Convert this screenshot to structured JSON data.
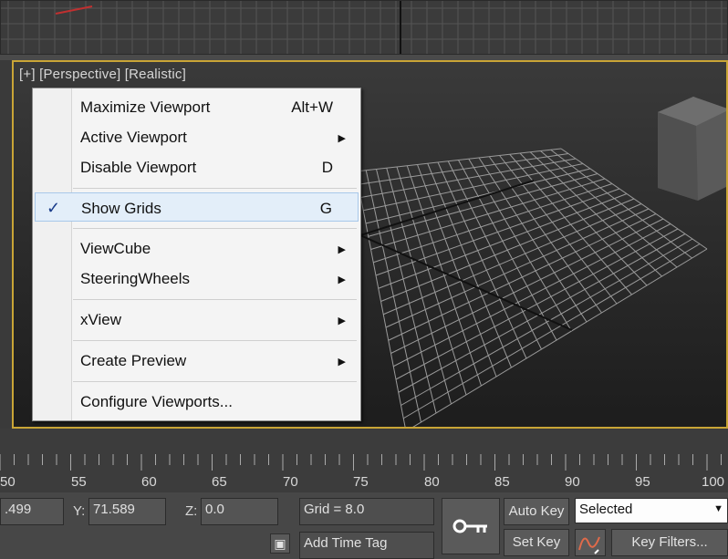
{
  "viewport": {
    "label_plus": "[+]",
    "label_view": "[Perspective]",
    "label_shading": "[Realistic]"
  },
  "context_menu": {
    "items": [
      {
        "label": "Maximize Viewport",
        "shortcut": "Alt+W",
        "submenu": false,
        "checked": false
      },
      {
        "label": "Active Viewport",
        "shortcut": "",
        "submenu": true,
        "checked": false
      },
      {
        "label": "Disable Viewport",
        "shortcut": "D",
        "submenu": false,
        "checked": false
      },
      {
        "label": "Show Grids",
        "shortcut": "G",
        "submenu": false,
        "checked": true
      },
      {
        "label": "ViewCube",
        "shortcut": "",
        "submenu": true,
        "checked": false
      },
      {
        "label": "SteeringWheels",
        "shortcut": "",
        "submenu": true,
        "checked": false
      },
      {
        "label": "xView",
        "shortcut": "",
        "submenu": true,
        "checked": false
      },
      {
        "label": "Create Preview",
        "shortcut": "",
        "submenu": true,
        "checked": false
      },
      {
        "label": "Configure Viewports...",
        "shortcut": "",
        "submenu": false,
        "checked": false
      }
    ],
    "check_glyph": "✓",
    "submenu_glyph": "▶"
  },
  "timeline": {
    "ticks": [
      "50",
      "55",
      "60",
      "65",
      "70",
      "75",
      "80",
      "85",
      "90",
      "95",
      "100"
    ]
  },
  "status": {
    "x_value": ".499",
    "y_label": "Y:",
    "y_value": "71.589",
    "z_label": "Z:",
    "z_value": "0.0",
    "grid": "Grid = 8.0",
    "add_time_tag": "Add Time Tag",
    "auto_key": "Auto Key",
    "set_key": "Set Key",
    "selection_dropdown": "Selected",
    "key_filters": "Key Filters..."
  },
  "colors": {
    "viewport_border": "#c9a536",
    "menu_bg": "#f4f4f4",
    "highlight": "#e3eef9"
  }
}
